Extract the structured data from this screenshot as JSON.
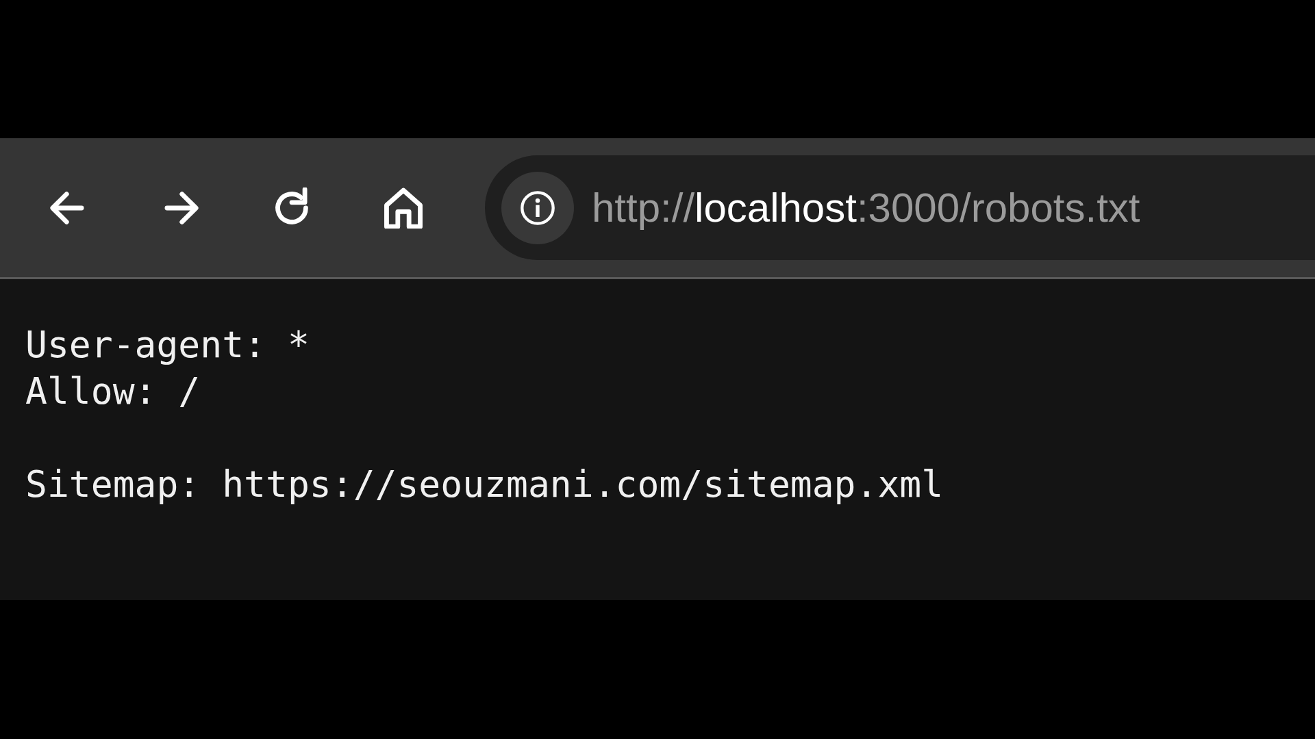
{
  "toolbar": {
    "buttons": [
      {
        "kind": "back"
      },
      {
        "kind": "forward"
      },
      {
        "kind": "reload"
      },
      {
        "kind": "home"
      }
    ],
    "address_bar": {
      "url_parts": [
        {
          "text": "http://",
          "kind": "dim"
        },
        {
          "text": "localhost",
          "kind": "bright"
        },
        {
          "text": ":3000/robots.txt",
          "kind": "dim"
        }
      ]
    }
  },
  "page": {
    "blocks": [
      [
        "User-agent: *",
        "Allow: /"
      ],
      [
        "Sitemap: https://seouzmani.com/sitemap.xml"
      ]
    ]
  }
}
